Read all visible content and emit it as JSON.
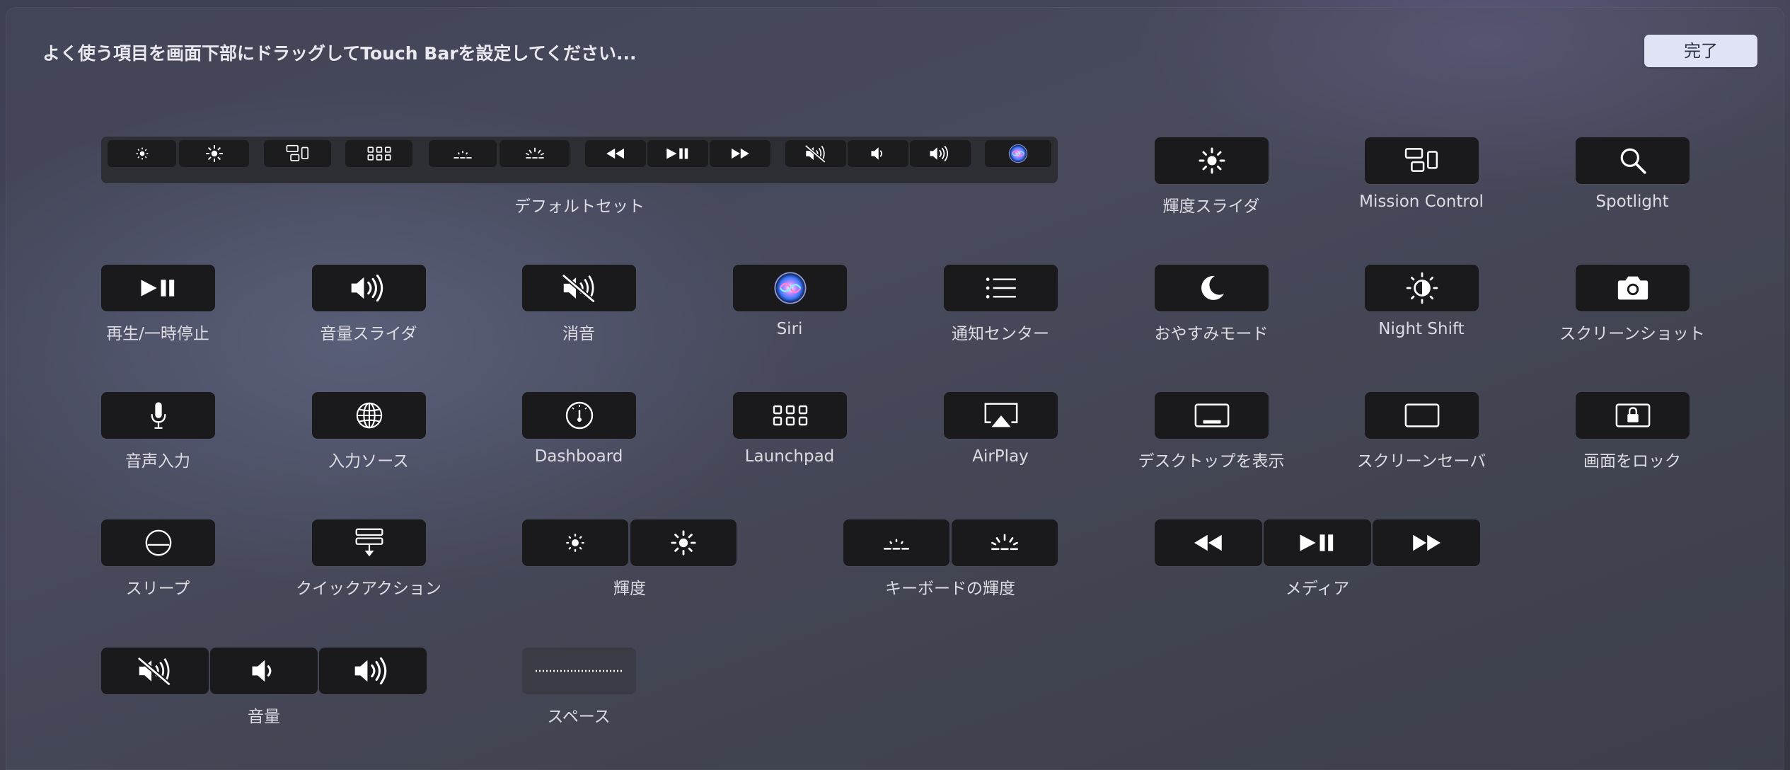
{
  "header": {
    "instruction": "よく使う項目を画面下部にドラッグしてTouch Barを設定してください...",
    "done_label": "完了"
  },
  "default_set": {
    "label": "デフォルトセット",
    "buttons": [
      "brightness-down-icon",
      "brightness-up-icon",
      "mission-control-icon",
      "launchpad-icon",
      "keyboard-brightness-down-icon",
      "keyboard-brightness-up-icon",
      "rewind-icon",
      "play-pause-icon",
      "fast-forward-icon",
      "mute-icon",
      "volume-down-icon",
      "volume-up-icon",
      "siri-icon"
    ]
  },
  "items": {
    "brightness_slider": "輝度スライダ",
    "mission_control": "Mission Control",
    "spotlight": "Spotlight",
    "play_pause": "再生/一時停止",
    "volume_slider": "音量スライダ",
    "mute": "消音",
    "siri": "Siri",
    "notification_center": "通知センター",
    "do_not_disturb": "おやすみモード",
    "night_shift": "Night Shift",
    "screenshot": "スクリーンショット",
    "dictation": "音声入力",
    "input_source": "入力ソース",
    "dashboard": "Dashboard",
    "launchpad": "Launchpad",
    "airplay": "AirPlay",
    "show_desktop": "デスクトップを表示",
    "screen_saver": "スクリーンセーバ",
    "lock_screen": "画面をロック",
    "sleep": "スリープ",
    "quick_actions": "クイックアクション",
    "brightness": "輝度",
    "keyboard_brightness": "キーボードの輝度",
    "media": "メディア",
    "volume": "音量",
    "space": "スペース"
  },
  "colors": {
    "key_background": "#1a1a1d",
    "done_button": "#dfe3f3",
    "siri_accent": "#6fa8ff"
  }
}
